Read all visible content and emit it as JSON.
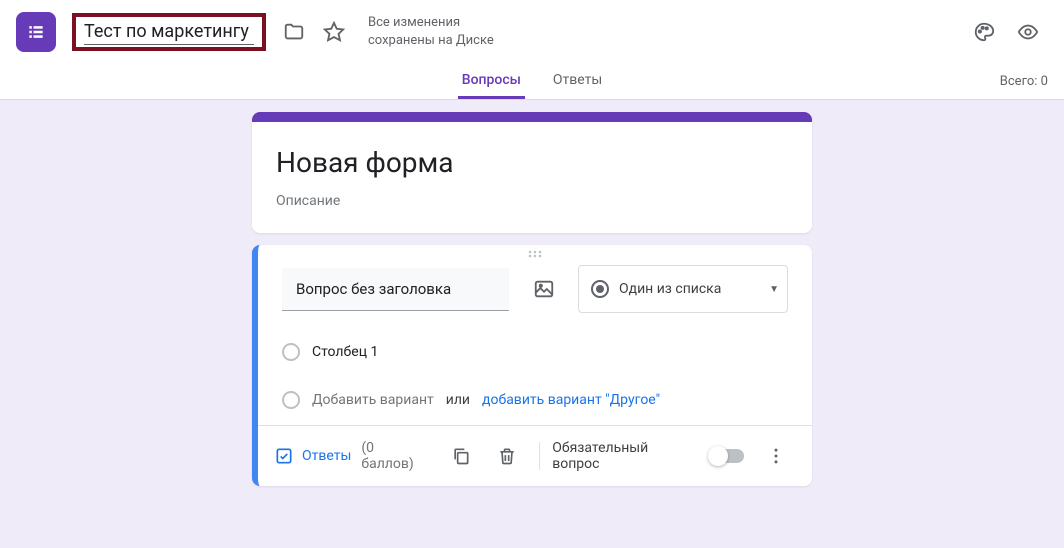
{
  "header": {
    "form_title": "Тест по маркетингу",
    "save_status": "Все изменения сохранены на Диске"
  },
  "tabs": {
    "questions": "Вопросы",
    "answers": "Ответы",
    "total": "Всего: 0"
  },
  "title_card": {
    "title": "Новая форма",
    "description": "Описание"
  },
  "question": {
    "title": "Вопрос без заголовка",
    "type_label": "Один из списка",
    "options": [
      {
        "label": "Столбец 1"
      }
    ],
    "add_option": "Добавить вариант",
    "or": "или",
    "add_other": "добавить вариант \"Другое\""
  },
  "footer": {
    "answer_key": "Ответы",
    "points": "(0 баллов)",
    "required": "Обязательный вопрос"
  }
}
